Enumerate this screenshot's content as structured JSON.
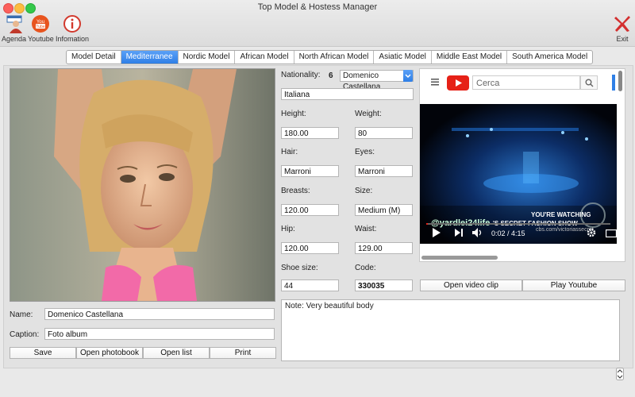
{
  "window": {
    "title": "Top Model & Hostess Manager"
  },
  "toolbar": {
    "agenda_label": "Agenda",
    "youtube_label": "Youtube",
    "information_label": "Infomation",
    "exit_label": "Exit"
  },
  "tabs": [
    "Model Detail",
    "Mediterranee",
    "Nordic Model",
    "African Model",
    "North African Model",
    "Asiatic Model",
    "Middle East Model",
    "South America Model"
  ],
  "details": {
    "nationality_label": "Nationality:",
    "count": "6",
    "model_select": "Domenico Castellana",
    "nationality_value": "Italiana",
    "height_label": "Height:",
    "height_value": "180.00",
    "weight_label": "Weight:",
    "weight_value": "80",
    "hair_label": "Hair:",
    "hair_value": "Marroni",
    "eyes_label": "Eyes:",
    "eyes_value": "Marroni",
    "breasts_label": "Breasts:",
    "breasts_value": "120.00",
    "size_label": "Size:",
    "size_value": "Medium (M)",
    "hip_label": "Hip:",
    "hip_value": "120.00",
    "waist_label": "Waist:",
    "waist_value": "129.00",
    "shoe_label": "Shoe size:",
    "shoe_value": "44",
    "code_label": "Code:",
    "code_value": "330035"
  },
  "form": {
    "name_label": "Name:",
    "name_value": "Domenico Castellana",
    "caption_label": "Caption:",
    "caption_value": "Foto album"
  },
  "buttons": {
    "save": "Save",
    "open_photobook": "Open photobook",
    "open_list": "Open list",
    "print": "Print",
    "open_video_clip": "Open video clip",
    "play_youtube": "Play Youtube"
  },
  "note": "Note: Very beautiful body",
  "youtube": {
    "search_placeholder": "Cerca",
    "watermark": "@yardlei24life",
    "caption_show": "'S SECRET FASHION SHOW",
    "now_watching": "YOU'RE WATCHING",
    "site": "cbs.com/victoriassecret",
    "time": "0:02 / 4:15",
    "progress_fraction": 0.01
  },
  "colors": {
    "accent": "#2f7fe6",
    "youtube_red": "#e62117"
  }
}
